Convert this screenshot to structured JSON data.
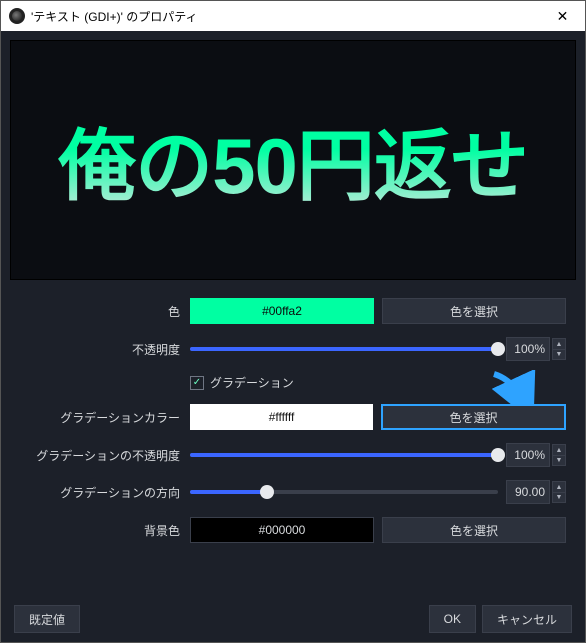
{
  "window": {
    "title": "'テキスト (GDI+)' のプロパティ"
  },
  "preview": {
    "text": "俺の50円返せ"
  },
  "controls": {
    "color": {
      "label": "色",
      "value": "#00ffa2",
      "pick": "色を選択"
    },
    "opacity": {
      "label": "不透明度",
      "value": "100%",
      "percent": 100
    },
    "gradient_checkbox": {
      "label": "グラデーション",
      "checked": true
    },
    "gradient_color": {
      "label": "グラデーションカラー",
      "value": "#ffffff",
      "pick": "色を選択"
    },
    "gradient_opacity": {
      "label": "グラデーションの不透明度",
      "value": "100%",
      "percent": 100
    },
    "gradient_direction": {
      "label": "グラデーションの方向",
      "value": "90.00",
      "percent": 25
    },
    "bgcolor": {
      "label": "背景色",
      "value": "#000000",
      "pick": "色を選択"
    }
  },
  "footer": {
    "defaults": "既定値",
    "ok": "OK",
    "cancel": "キャンセル"
  }
}
